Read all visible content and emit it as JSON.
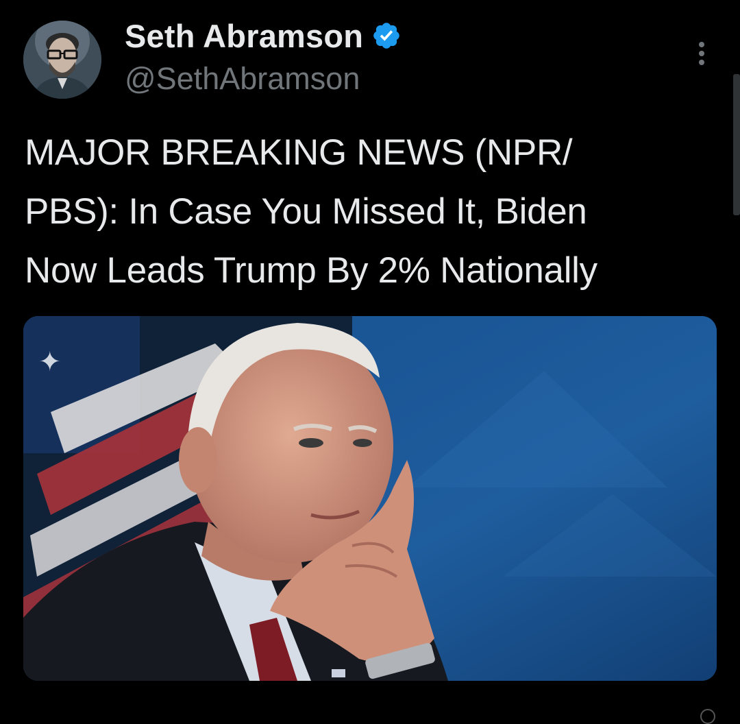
{
  "tweet": {
    "author": {
      "display_name": "Seth Abramson",
      "handle": "@SethAbramson",
      "verified": true,
      "verified_icon": "verified-badge-icon",
      "avatar_icon": "avatar-photo"
    },
    "text_lines": [
      "MAJOR BREAKING NEWS (NPR/",
      "PBS): In Case You Missed It, Biden",
      "Now Leads Trump By 2% Nationally"
    ],
    "more_icon": "more-vertical-icon",
    "media": {
      "type": "photo",
      "description_icon": "news-photo"
    }
  },
  "colors": {
    "background": "#000000",
    "text_primary": "#e7e9ea",
    "text_secondary": "#71767b",
    "verified_blue": "#1d9bf0"
  }
}
